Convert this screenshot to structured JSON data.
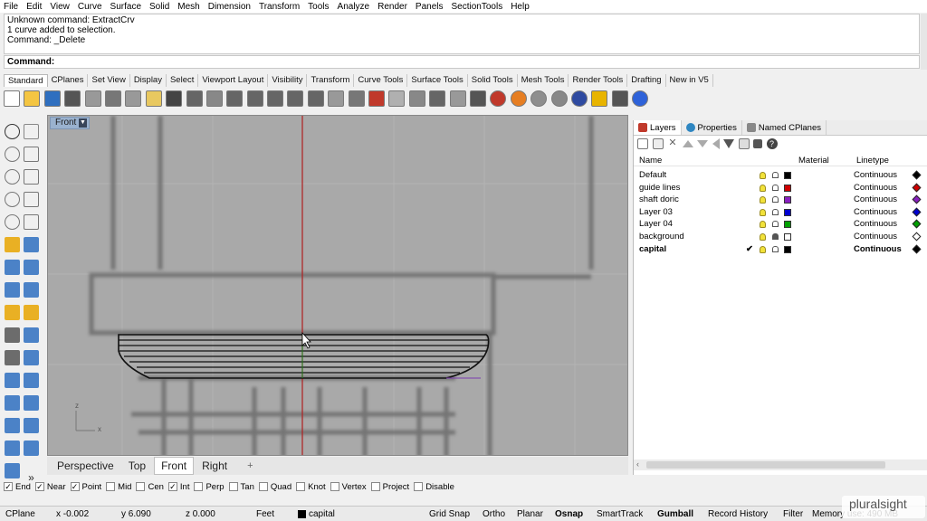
{
  "menu": [
    "File",
    "Edit",
    "View",
    "Curve",
    "Surface",
    "Solid",
    "Mesh",
    "Dimension",
    "Transform",
    "Tools",
    "Analyze",
    "Render",
    "Panels",
    "SectionTools",
    "Help"
  ],
  "command_history": [
    "Unknown command: ExtractCrv",
    "1 curve added to selection.",
    "Command: _Delete"
  ],
  "command_prompt": "Command:",
  "toolbar_tabs": [
    "Standard",
    "CPlanes",
    "Set View",
    "Display",
    "Select",
    "Viewport Layout",
    "Visibility",
    "Transform",
    "Curve Tools",
    "Surface Tools",
    "Solid Tools",
    "Mesh Tools",
    "Render Tools",
    "Drafting",
    "New in V5"
  ],
  "toolbar_icons": [
    "new-icon",
    "open-icon",
    "save-icon",
    "print-icon",
    "import-icon",
    "cut-icon",
    "copy-icon",
    "paste-icon",
    "undo-icon",
    "pan-icon",
    "rotate-view-icon",
    "zoom-icon",
    "zoom-window-icon",
    "zoom-extents-icon",
    "zoom-selected-icon",
    "rotate-icon",
    "select-icon",
    "grid-icon",
    "car-icon",
    "curve-icon",
    "move-icon",
    "light-icon",
    "cube-icon",
    "lock-icon",
    "shaded-icon",
    "color-wheel-icon",
    "sphere-icon",
    "material-icon",
    "render-icon",
    "spotlight-icon",
    "options-icon",
    "help-icon"
  ],
  "sidebar_icons": [
    "select-arrow-icon",
    "point-icon",
    "polyline-icon",
    "curve-icon",
    "circle-icon",
    "ellipse-icon",
    "polygon-icon",
    "rectangle-icon",
    "arc-icon",
    "fillet-icon",
    "surface-icon",
    "loft-icon",
    "box-icon",
    "sphere-icon",
    "cylinder-icon",
    "extrude-icon",
    "explode-icon",
    "trim-icon",
    "boolean-icon",
    "split-icon",
    "move-icon",
    "copy-icon",
    "mirror-icon",
    "rotate-icon",
    "scale-icon",
    "array-icon",
    "group-icon",
    "dimension-icon",
    "block-icon",
    "history-icon",
    "text-icon",
    "more-icon"
  ],
  "viewport": {
    "name": "Front",
    "dropdown": "▼",
    "axis_z": "z",
    "axis_x": "x",
    "tabs": [
      "Perspective",
      "Top",
      "Front",
      "Right"
    ],
    "active_tab": "Front",
    "add_tab": "+"
  },
  "osnaps": [
    {
      "label": "End",
      "checked": true
    },
    {
      "label": "Near",
      "checked": true
    },
    {
      "label": "Point",
      "checked": true
    },
    {
      "label": "Mid",
      "checked": false
    },
    {
      "label": "Cen",
      "checked": false
    },
    {
      "label": "Int",
      "checked": true
    },
    {
      "label": "Perp",
      "checked": false
    },
    {
      "label": "Tan",
      "checked": false
    },
    {
      "label": "Quad",
      "checked": false
    },
    {
      "label": "Knot",
      "checked": false
    },
    {
      "label": "Vertex",
      "checked": false
    },
    {
      "label": "Project",
      "checked": false
    },
    {
      "label": "Disable",
      "checked": false
    }
  ],
  "status": {
    "cplane": "CPlane",
    "x": "x -0.002",
    "y": "y 6.090",
    "z": "z 0.000",
    "units": "Feet",
    "layer": "capital",
    "grid_snap": "Grid Snap",
    "ortho": "Ortho",
    "planar": "Planar",
    "osnap": "Osnap",
    "smarttrack": "SmartTrack",
    "gumball": "Gumball",
    "record_history": "Record History",
    "filter": "Filter",
    "memory": "Memory use: 490 MB"
  },
  "panel": {
    "tabs": [
      "Layers",
      "Properties",
      "Named CPlanes"
    ],
    "headers": {
      "name": "Name",
      "material": "Material",
      "linetype": "Linetype"
    },
    "layers": [
      {
        "name": "Default",
        "color": "#000000",
        "linetype": "Continuous",
        "current": false,
        "locked": false
      },
      {
        "name": "guide lines",
        "color": "#d00000",
        "linetype": "Continuous",
        "current": false,
        "locked": false
      },
      {
        "name": "shaft doric",
        "color": "#8a1fc0",
        "linetype": "Continuous",
        "current": false,
        "locked": false
      },
      {
        "name": "Layer 03",
        "color": "#0000d0",
        "linetype": "Continuous",
        "current": false,
        "locked": false
      },
      {
        "name": "Layer 04",
        "color": "#00a000",
        "linetype": "Continuous",
        "current": false,
        "locked": false
      },
      {
        "name": "background",
        "color": "#ffffff",
        "linetype": "Continuous",
        "current": false,
        "locked": true
      },
      {
        "name": "capital",
        "color": "#000000",
        "linetype": "Continuous",
        "current": true,
        "locked": false
      }
    ],
    "current_mark": "✔"
  },
  "watermark": {
    "brand": "pluralsight"
  }
}
